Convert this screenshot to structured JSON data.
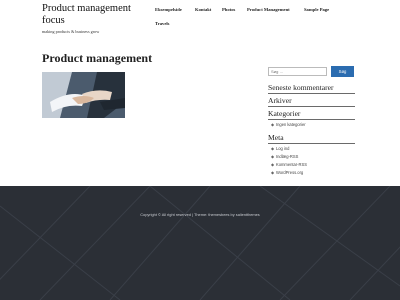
{
  "site": {
    "title": "Product management focus",
    "tagline": "making products & business grow"
  },
  "nav": {
    "items": [
      "Eksempelside",
      "Kontakt",
      "Photos",
      "Product Management",
      "Sample Page",
      "Travels"
    ]
  },
  "main": {
    "page_title": "Product management"
  },
  "sidebar": {
    "search_placeholder": "Søg …",
    "search_button": "Søg",
    "recent_comments_heading": "Seneste kommentarer",
    "archives_heading": "Arkiver",
    "categories_heading": "Kategorier",
    "categories": [
      "Ingen kategorier"
    ],
    "meta_heading": "Meta",
    "meta_links": [
      "Log ind",
      "Indlæg-RSS",
      "Kommentar-RSS",
      "WordPress.org"
    ]
  },
  "footer": {
    "copyright": "Copyright © All right reserved | Theme: themesbees by salientthemes"
  },
  "colors": {
    "accent": "#2b6cb0",
    "footer_bg": "#2b2f36"
  }
}
